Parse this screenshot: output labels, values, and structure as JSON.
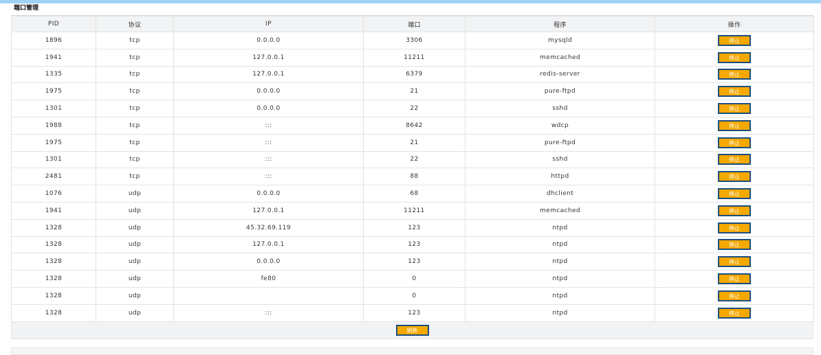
{
  "panel": {
    "title": "端口管理"
  },
  "table": {
    "headers": [
      "PID",
      "协议",
      "IP",
      "端口",
      "程序",
      "操作"
    ],
    "rows": [
      {
        "pid": "1896",
        "protocol": "tcp",
        "ip": "0.0.0.0",
        "port": "3306",
        "program": "mysqld"
      },
      {
        "pid": "1941",
        "protocol": "tcp",
        "ip": "127.0.0.1",
        "port": "11211",
        "program": "memcached"
      },
      {
        "pid": "1335",
        "protocol": "tcp",
        "ip": "127.0.0.1",
        "port": "6379",
        "program": "redis-server"
      },
      {
        "pid": "1975",
        "protocol": "tcp",
        "ip": "0.0.0.0",
        "port": "21",
        "program": "pure-ftpd"
      },
      {
        "pid": "1301",
        "protocol": "tcp",
        "ip": "0.0.0.0",
        "port": "22",
        "program": "sshd"
      },
      {
        "pid": "1988",
        "protocol": "tcp",
        "ip": ":::",
        "port": "8642",
        "program": "wdcp"
      },
      {
        "pid": "1975",
        "protocol": "tcp",
        "ip": ":::",
        "port": "21",
        "program": "pure-ftpd"
      },
      {
        "pid": "1301",
        "protocol": "tcp",
        "ip": ":::",
        "port": "22",
        "program": "sshd"
      },
      {
        "pid": "2481",
        "protocol": "tcp",
        "ip": ":::",
        "port": "88",
        "program": "httpd"
      },
      {
        "pid": "1076",
        "protocol": "udp",
        "ip": "0.0.0.0",
        "port": "68",
        "program": "dhclient"
      },
      {
        "pid": "1941",
        "protocol": "udp",
        "ip": "127.0.0.1",
        "port": "11211",
        "program": "memcached"
      },
      {
        "pid": "1328",
        "protocol": "udp",
        "ip": "45.32.69.119",
        "port": "123",
        "program": "ntpd"
      },
      {
        "pid": "1328",
        "protocol": "udp",
        "ip": "127.0.0.1",
        "port": "123",
        "program": "ntpd"
      },
      {
        "pid": "1328",
        "protocol": "udp",
        "ip": "0.0.0.0",
        "port": "123",
        "program": "ntpd"
      },
      {
        "pid": "1328",
        "protocol": "udp",
        "ip": "fe80",
        "port": "0",
        "program": "ntpd"
      },
      {
        "pid": "1328",
        "protocol": "udp",
        "ip": "",
        "port": "0",
        "program": "ntpd"
      },
      {
        "pid": "1328",
        "protocol": "udp",
        "ip": ":::",
        "port": "123",
        "program": "ntpd"
      }
    ],
    "stop_label": "停止"
  },
  "footer": {
    "refresh_label": "刷新"
  },
  "colors": {
    "accent_button": "#f5a800",
    "button_border": "#1c4e80",
    "top_bar": "#9fd2f5"
  }
}
